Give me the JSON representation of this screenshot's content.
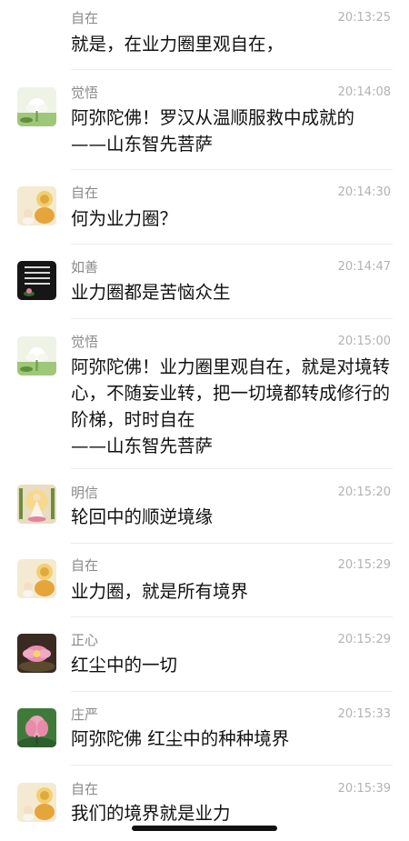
{
  "messages": [
    {
      "name": "自在",
      "time": "20:13:25",
      "avatar_icon": "buddha-avatar-icon",
      "lines": [
        "就是，在业力圈里观自在，"
      ]
    },
    {
      "name": "觉悟",
      "time": "20:14:08",
      "avatar_icon": "white-lotus-avatar-icon",
      "lines": [
        "阿弥陀佛！罗汉从温顺服救中成就的",
        "——山东智先菩萨"
      ]
    },
    {
      "name": "自在",
      "time": "20:14:30",
      "avatar_icon": "buddha-avatar-icon",
      "lines": [
        "何为业力圈？"
      ]
    },
    {
      "name": "如善",
      "time": "20:14:47",
      "avatar_icon": "dark-calligraphy-avatar-icon",
      "lines": [
        "业力圈都是苦恼众生"
      ]
    },
    {
      "name": "觉悟",
      "time": "20:15:00",
      "avatar_icon": "white-lotus-avatar-icon",
      "lines": [
        "阿弥陀佛！业力圈里观自在，就是对境转",
        "心，不随妄业转，把一切境都转成修行的",
        "阶梯，时时自在",
        "——山东智先菩萨"
      ]
    },
    {
      "name": "明信",
      "time": "20:15:20",
      "avatar_icon": "guanyin-avatar-icon",
      "lines": [
        "轮回中的顺逆境缘"
      ]
    },
    {
      "name": "自在",
      "time": "20:15:29",
      "avatar_icon": "buddha-avatar-icon",
      "lines": [
        "业力圈，就是所有境界"
      ]
    },
    {
      "name": "正心",
      "time": "20:15:29",
      "avatar_icon": "pink-lotus-dark-avatar-icon",
      "lines": [
        "红尘中的一切"
      ]
    },
    {
      "name": "庄严",
      "time": "20:15:33",
      "avatar_icon": "pink-lotus-green-avatar-icon",
      "lines": [
        "阿弥陀佛 红尘中的种种境界"
      ]
    },
    {
      "name": "自在",
      "time": "20:15:39",
      "avatar_icon": "buddha-avatar-icon",
      "lines": [
        "我们的境界就是业力"
      ]
    }
  ]
}
